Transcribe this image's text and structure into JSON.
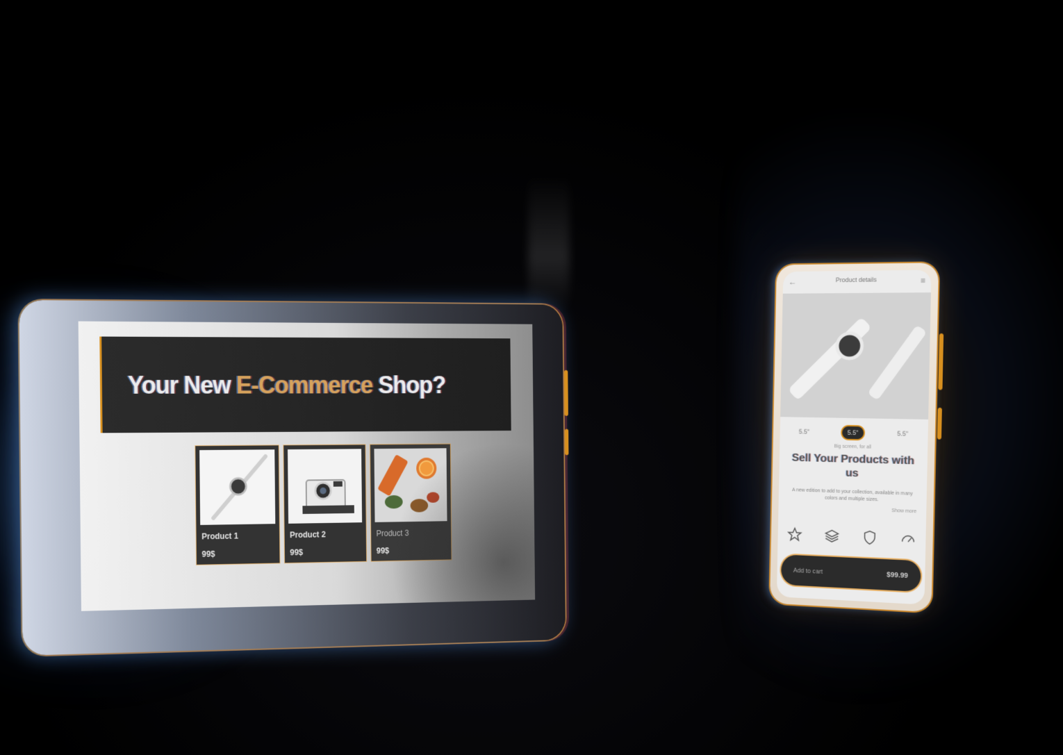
{
  "tablet": {
    "hero": {
      "title_part1": "Your New ",
      "title_accent": "E-Commerce",
      "title_part2": " Shop?"
    },
    "products": [
      {
        "name": "Product 1",
        "price": "99$",
        "image": "watch-icon"
      },
      {
        "name": "Product 2",
        "price": "99$",
        "image": "camera-icon"
      },
      {
        "name": "Product 3",
        "price": "99$",
        "image": "fruit-photo"
      }
    ]
  },
  "phone": {
    "topbar_title": "Product details",
    "back_icon": "back-arrow-icon",
    "menu_icon": "menu-icon",
    "hero_image": "smartwatch-photo",
    "sizes": [
      {
        "label": "5.5\"",
        "active": false
      },
      {
        "label": "5.5\"",
        "active": true
      },
      {
        "label": "5.5\"",
        "active": false
      }
    ],
    "subtitle": "Big screen, for all",
    "heading": "Sell Your Products with us",
    "description": "A new edition to add to your collection, available in many colors and multiple sizes.",
    "more_link": "Show more",
    "features": [
      "star-icon",
      "layers-icon",
      "shield-icon",
      "gauge-icon"
    ],
    "cart": {
      "label": "Add to cart",
      "price": "$99.99"
    }
  },
  "colors": {
    "accent": "#d6a25c",
    "frame_highlight": "#d8901f",
    "background": "#000000"
  }
}
